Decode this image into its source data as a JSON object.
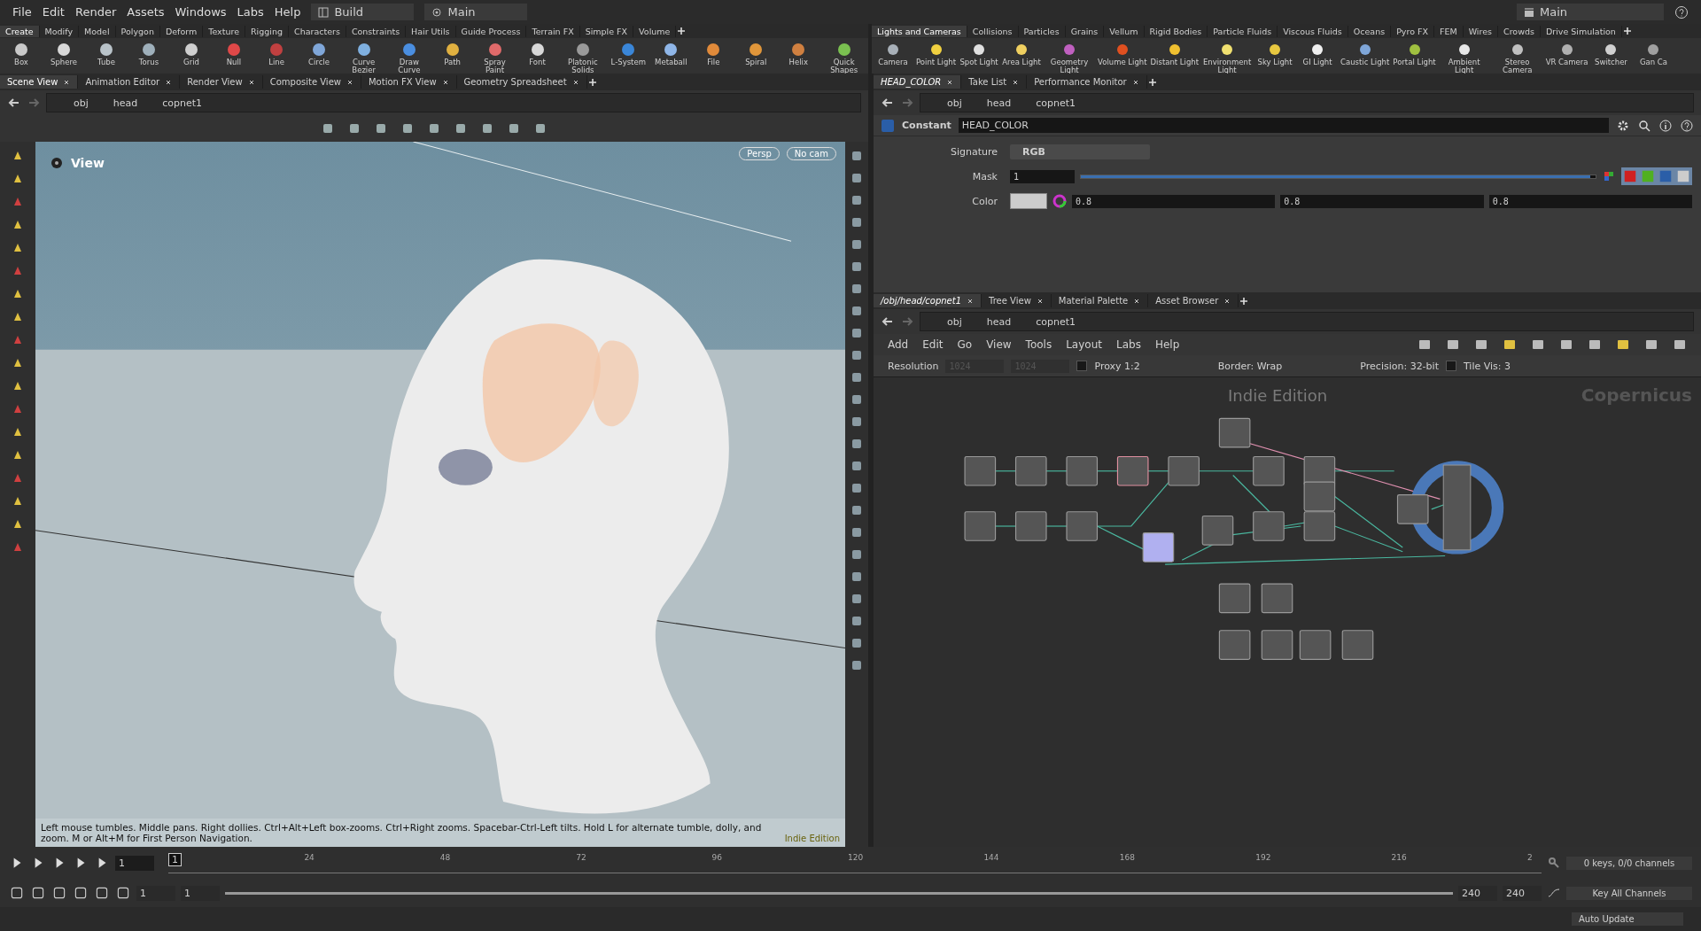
{
  "menu": [
    "File",
    "Edit",
    "Render",
    "Assets",
    "Windows",
    "Labs",
    "Help"
  ],
  "desktop": {
    "build": "Build",
    "main": "Main"
  },
  "right_desktop": "Main",
  "shelf_left": {
    "tabs": [
      {
        "label": "Create",
        "selected": true
      },
      {
        "label": "Modify",
        "selected": false
      },
      {
        "label": "Model",
        "selected": false
      },
      {
        "label": "Polygon",
        "selected": false
      },
      {
        "label": "Deform",
        "selected": false
      },
      {
        "label": "Texture",
        "selected": false
      },
      {
        "label": "Rigging",
        "selected": false
      },
      {
        "label": "Characters",
        "selected": false
      },
      {
        "label": "Constraints",
        "selected": false
      },
      {
        "label": "Hair Utils",
        "selected": false
      },
      {
        "label": "Guide Process",
        "selected": false
      },
      {
        "label": "Terrain FX",
        "selected": false
      },
      {
        "label": "Simple FX",
        "selected": false
      },
      {
        "label": "Volume",
        "selected": false
      }
    ],
    "tools": [
      "Box",
      "Sphere",
      "Tube",
      "Torus",
      "Grid",
      "Null",
      "Line",
      "Circle",
      "Curve Bezier",
      "Draw Curve",
      "Path",
      "Spray Paint",
      "Font",
      "Platonic Solids",
      "L-System",
      "Metaball",
      "File",
      "Spiral",
      "Helix",
      "Quick Shapes"
    ]
  },
  "shelf_right": {
    "tabs": [
      {
        "label": "Lights and Cameras",
        "selected": true
      },
      {
        "label": "Collisions",
        "selected": false
      },
      {
        "label": "Particles",
        "selected": false
      },
      {
        "label": "Grains",
        "selected": false
      },
      {
        "label": "Vellum",
        "selected": false
      },
      {
        "label": "Rigid Bodies",
        "selected": false
      },
      {
        "label": "Particle Fluids",
        "selected": false
      },
      {
        "label": "Viscous Fluids",
        "selected": false
      },
      {
        "label": "Oceans",
        "selected": false
      },
      {
        "label": "Pyro FX",
        "selected": false
      },
      {
        "label": "FEM",
        "selected": false
      },
      {
        "label": "Wires",
        "selected": false
      },
      {
        "label": "Crowds",
        "selected": false
      },
      {
        "label": "Drive Simulation",
        "selected": false
      }
    ],
    "tools": [
      "Camera",
      "Point Light",
      "Spot Light",
      "Area Light",
      "Geometry Light",
      "Volume Light",
      "Distant Light",
      "Environment Light",
      "Sky Light",
      "GI Light",
      "Caustic Light",
      "Portal Light",
      "Ambient Light",
      "Stereo Camera",
      "VR Camera",
      "Switcher",
      "Gan Ca"
    ]
  },
  "scene_pane": {
    "tabs": [
      {
        "label": "Scene View",
        "selected": true
      },
      {
        "label": "Animation Editor",
        "selected": false
      },
      {
        "label": "Render View",
        "selected": false
      },
      {
        "label": "Composite View",
        "selected": false
      },
      {
        "label": "Motion FX View",
        "selected": false
      },
      {
        "label": "Geometry Spreadsheet",
        "selected": false
      }
    ],
    "path": [
      "obj",
      "head",
      "copnet1"
    ],
    "viewport": {
      "title": "View",
      "camera_buttons": [
        "Persp",
        "No cam"
      ],
      "status": "Left mouse tumbles. Middle pans. Right dollies. Ctrl+Alt+Left box-zooms. Ctrl+Right zooms. Spacebar-Ctrl-Left tilts. Hold L for alternate tumble, dolly, and zoom. M or Alt+M for First Person Navigation.",
      "watermark": "Indie Edition"
    }
  },
  "param_pane": {
    "tabs": [
      {
        "label": "HEAD_COLOR",
        "selected": true
      },
      {
        "label": "Take List",
        "selected": false
      },
      {
        "label": "Performance Monitor",
        "selected": false
      }
    ],
    "path": [
      "obj",
      "head",
      "copnet1"
    ],
    "node_type": "Constant",
    "node_name": "HEAD_COLOR",
    "signature": {
      "label": "Signature",
      "value": "RGB"
    },
    "mask": {
      "label": "Mask",
      "value": "1",
      "level": 0.99
    },
    "color": {
      "label": "Color",
      "values": [
        "0.8",
        "0.8",
        "0.8"
      ]
    }
  },
  "network_pane": {
    "tabs": [
      {
        "label": "/obj/head/copnet1",
        "selected": true
      },
      {
        "label": "Tree View",
        "selected": false
      },
      {
        "label": "Material Palette",
        "selected": false
      },
      {
        "label": "Asset Browser",
        "selected": false
      }
    ],
    "path": [
      "obj",
      "head",
      "copnet1"
    ],
    "menu": [
      "Add",
      "Edit",
      "Go",
      "View",
      "Tools",
      "Layout",
      "Labs",
      "Help"
    ],
    "resolution": {
      "label": "Resolution",
      "values": [
        "1024",
        "1024"
      ]
    },
    "proxy": {
      "label": "Proxy 1:2",
      "checked": false
    },
    "border": "Border: Wrap",
    "precision": "Precision: 32-bit",
    "tile_vis": {
      "label": "Tile Vis: 3",
      "checked": false
    },
    "watermark": "Indie Edition",
    "context": "Copernicus"
  },
  "timeline": {
    "frame": "1",
    "current": "1",
    "ticks": [
      "24",
      "48",
      "72",
      "96",
      "120",
      "144",
      "168",
      "192",
      "216",
      "2"
    ],
    "range_start": [
      "1",
      "1"
    ],
    "range_end": [
      "240",
      "240"
    ],
    "range": {
      "level": 1
    },
    "keys": "0 keys, 0/0 channels",
    "key_all": "Key All Channels",
    "auto_update": "Auto Update"
  }
}
